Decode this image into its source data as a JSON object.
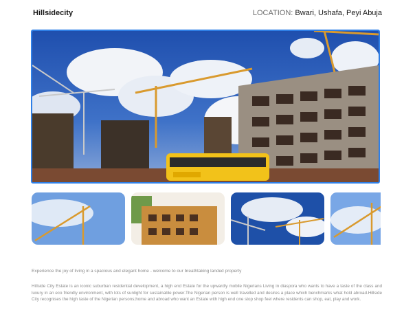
{
  "header": {
    "brand": "Hillsidecity",
    "location_label": "LOCATION:",
    "location_value": "Bwari, Ushafa, Peyi Abuja"
  },
  "colors": {
    "accent_border": "#2f7fe6",
    "sky": "#2f5fb8",
    "crane": "#e0a23a"
  },
  "gallery": {
    "thumb_count_visible": 4
  },
  "content": {
    "intro": "Experience the joy of living in a spacious and elegant home - welcome to our breathtaking landed property",
    "description": "Hillside City Estate is an iconic suburban residential development, a high end Estate for the upwardly mobile Nigerians Living in diaspora who wants to have a taste of the class and luxury in an eco friendly environment, with lots of sunlight for sustainable power.The Nigerian person is well travelled and desires a place which benchmarks what hold abroad.Hillside City recognises the high taste of the Nigerian persons;home and abroad who want an Estate with high end one stop shop feel where residents can shop, eat, play and work."
  }
}
